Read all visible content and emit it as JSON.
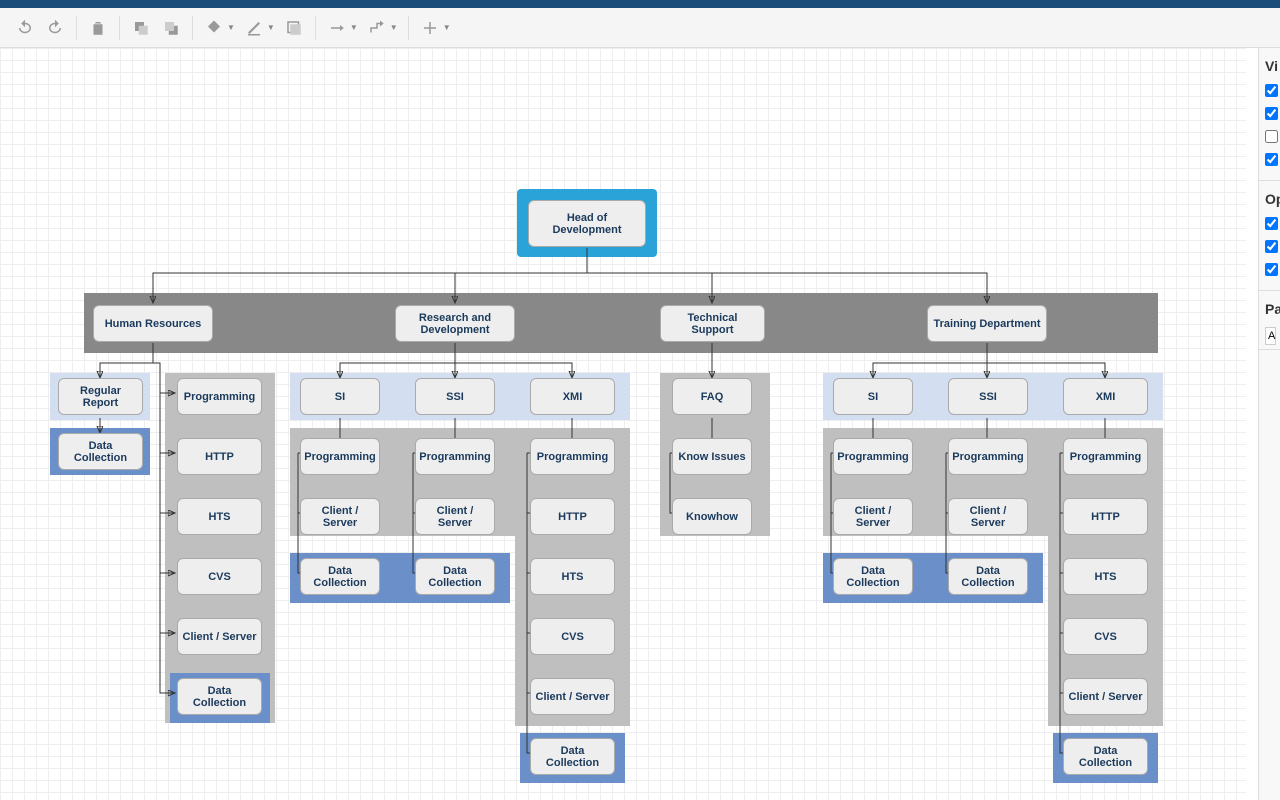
{
  "toolbar": {
    "undo": "undo-icon",
    "redo": "redo-icon",
    "delete": "delete-icon",
    "front": "front-icon",
    "back": "back-icon",
    "fill": "fill-icon",
    "line": "line-icon",
    "shadow": "shadow-icon",
    "connection": "connection-icon",
    "waypoints": "waypoints-icon",
    "insert": "insert-icon"
  },
  "sidebar": {
    "view_title": "Vi",
    "options_title": "Op",
    "paper_title": "Pa",
    "checks": [
      true,
      true,
      false,
      true,
      true,
      true,
      true
    ],
    "paper_value": "A"
  },
  "diagram": {
    "root": "Head of Development",
    "dept": [
      "Human Resources",
      "Research and Development",
      "Technical Support",
      "Training Department"
    ],
    "hr": {
      "regular_report": "Regular Report",
      "data_collection": "Data Collection",
      "programming": "Programming",
      "http": "HTTP",
      "hts": "HTS",
      "cvs": "CVS",
      "client_server": "Client / Server",
      "dc2": "Data Collection"
    },
    "rd": {
      "si": "SI",
      "ssi": "SSI",
      "xmi": "XMI",
      "si_items": [
        "Programming",
        "Client / Server",
        "Data Collection"
      ],
      "ssi_items": [
        "Programming",
        "Client / Server",
        "Data Collection"
      ],
      "xmi_items": [
        "Programming",
        "HTTP",
        "HTS",
        "CVS",
        "Client / Server",
        "Data Collection"
      ]
    },
    "ts": {
      "faq": "FAQ",
      "know_issues": "Know Issues",
      "knowhow": "Knowhow"
    },
    "td": {
      "si": "SI",
      "ssi": "SSI",
      "xmi": "XMI",
      "si_items": [
        "Programming",
        "Client / Server",
        "Data Collection"
      ],
      "ssi_items": [
        "Programming",
        "Client / Server",
        "Data Collection"
      ],
      "xmi_items": [
        "Programming",
        "HTTP",
        "HTS",
        "CVS",
        "Client / Server",
        "Data Collection"
      ]
    }
  }
}
